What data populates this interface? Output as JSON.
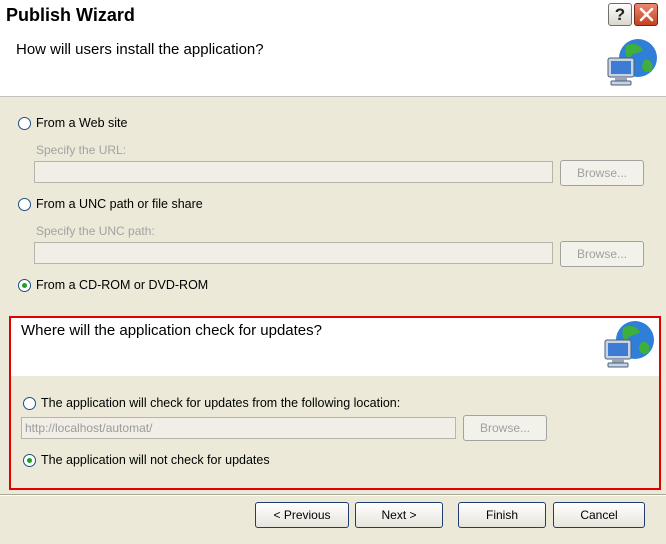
{
  "window": {
    "title": "Publish Wizard",
    "help_glyph": "?",
    "close_icon": "close-x-icon"
  },
  "install": {
    "header": "How will users install the application?",
    "header_icon": "globe-computer-icon",
    "options": [
      {
        "label": "From a Web site",
        "selected": false,
        "sublabel": "Specify the URL:",
        "value": "",
        "browse_label": "Browse..."
      },
      {
        "label": "From a UNC path or file share",
        "selected": false,
        "sublabel": "Specify the UNC path:",
        "value": "",
        "browse_label": "Browse..."
      },
      {
        "label": "From a CD-ROM or DVD-ROM",
        "selected": true
      }
    ]
  },
  "updates": {
    "header": "Where will the application check for updates?",
    "header_icon": "globe-computer-icon",
    "options": [
      {
        "label": "The application will check for updates from the following location:",
        "selected": false,
        "value": "http://localhost/automat/",
        "browse_label": "Browse..."
      },
      {
        "label": "The application will not check for updates",
        "selected": true
      }
    ]
  },
  "buttons": {
    "previous": "< Previous",
    "next": "Next >",
    "finish": "Finish",
    "cancel": "Cancel"
  }
}
